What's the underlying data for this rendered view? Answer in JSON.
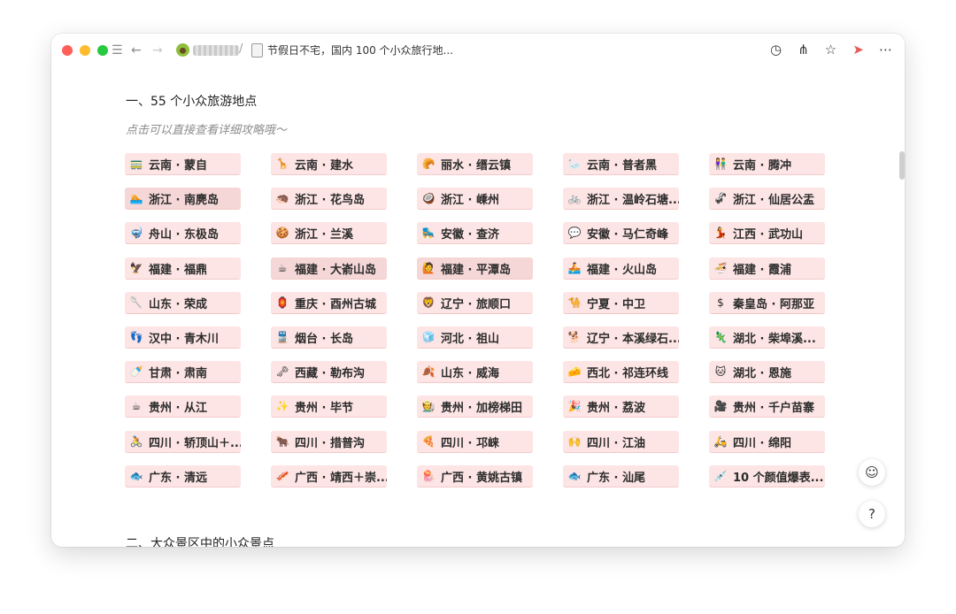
{
  "window": {
    "title": "节假日不宅，国内 100 个小众旅行地...",
    "breadcrumb_sep": "/"
  },
  "toolbar": {
    "back_icon": "←",
    "forward_icon": "→",
    "menu_icon": "☰",
    "history_icon": "◷",
    "share_icon": "⋔",
    "star_icon": "☆",
    "send_icon": "➤",
    "more_icon": "⋯"
  },
  "content": {
    "section1_title": "一、55 个小众旅游地点",
    "hint": "点击可以直接查看详细攻略哦～",
    "section2_title": "二、大众景区中的小众景点",
    "places": [
      [
        "云南 · 蒙自",
        "云南 · 建水",
        "丽水 · 缙云镇",
        "云南 · 普者黑",
        "云南 · 腾冲"
      ],
      [
        "浙江 · 南麂岛",
        "浙江 · 花鸟岛",
        "浙江 · 嵊州",
        "浙江 · 温岭石塘...",
        "浙江 · 仙居公盂"
      ],
      [
        "舟山 · 东极岛",
        "浙江 · 兰溪",
        "安徽 · 查济",
        "安徽 · 马仁奇峰",
        "江西 · 武功山"
      ],
      [
        "福建 · 福鼎",
        "福建 · 大嵛山岛",
        "福建 · 平潭岛",
        "福建 · 火山岛",
        "福建 · 霞浦"
      ],
      [
        "山东 · 荣成",
        "重庆 · 酉州古城",
        "辽宁 · 旅顺口",
        "宁夏 · 中卫",
        "秦皇岛 · 阿那亚"
      ],
      [
        "汉中 · 青木川",
        "烟台 · 长岛",
        "河北 · 祖山",
        "辽宁 · 本溪绿石...",
        "湖北 · 柴埠溪..."
      ],
      [
        "甘肃 · 肃南",
        "西藏 · 勒布沟",
        "山东 · 威海",
        "西北 · 祁连环线",
        "湖北 · 恩施"
      ],
      [
        "贵州 · 从江",
        "贵州 · 毕节",
        "贵州 · 加榜梯田",
        "贵州 · 荔波",
        "贵州 · 千户苗寨"
      ],
      [
        "四川 · 轿顶山＋...",
        "四川 · 措普沟",
        "四川 · 邛崃",
        "四川 · 江油",
        "四川 · 绵阳"
      ],
      [
        "广东 · 清远",
        "广西 · 靖西＋崇...",
        "广西 · 黄姚古镇",
        "广东 · 汕尾",
        "10 个颜值爆表..."
      ]
    ],
    "place_icons": [
      [
        "🚃",
        "🦒",
        "🥐",
        "🦢",
        "👫"
      ],
      [
        "🏊",
        "🦔",
        "🥥",
        "🚲",
        "🦨"
      ],
      [
        "🤿",
        "🍪",
        "🛼",
        "💬",
        "💃"
      ],
      [
        "🦅",
        "☕",
        "🙋",
        "🚣",
        "🍜"
      ],
      [
        "🥄",
        "🏮",
        "🦁",
        "🐪",
        "$"
      ],
      [
        "👣",
        "🚆",
        "🧊",
        "🐕",
        "🦎"
      ],
      [
        "🍼",
        "🗝",
        "🍂",
        "🧀",
        "🐱"
      ],
      [
        "☕",
        "✨",
        "🧑‍🌾",
        "🎉",
        "🎥"
      ],
      [
        "🚴",
        "🐂",
        "🍕",
        "🙌",
        "🛵"
      ],
      [
        "🐟",
        "🥓",
        "🪼",
        "🐟",
        "💉"
      ]
    ],
    "highlighted": [
      "1-0",
      "3-1",
      "3-2"
    ]
  },
  "float_buttons": {
    "feedback_icon": "☺",
    "help_label": "?"
  }
}
